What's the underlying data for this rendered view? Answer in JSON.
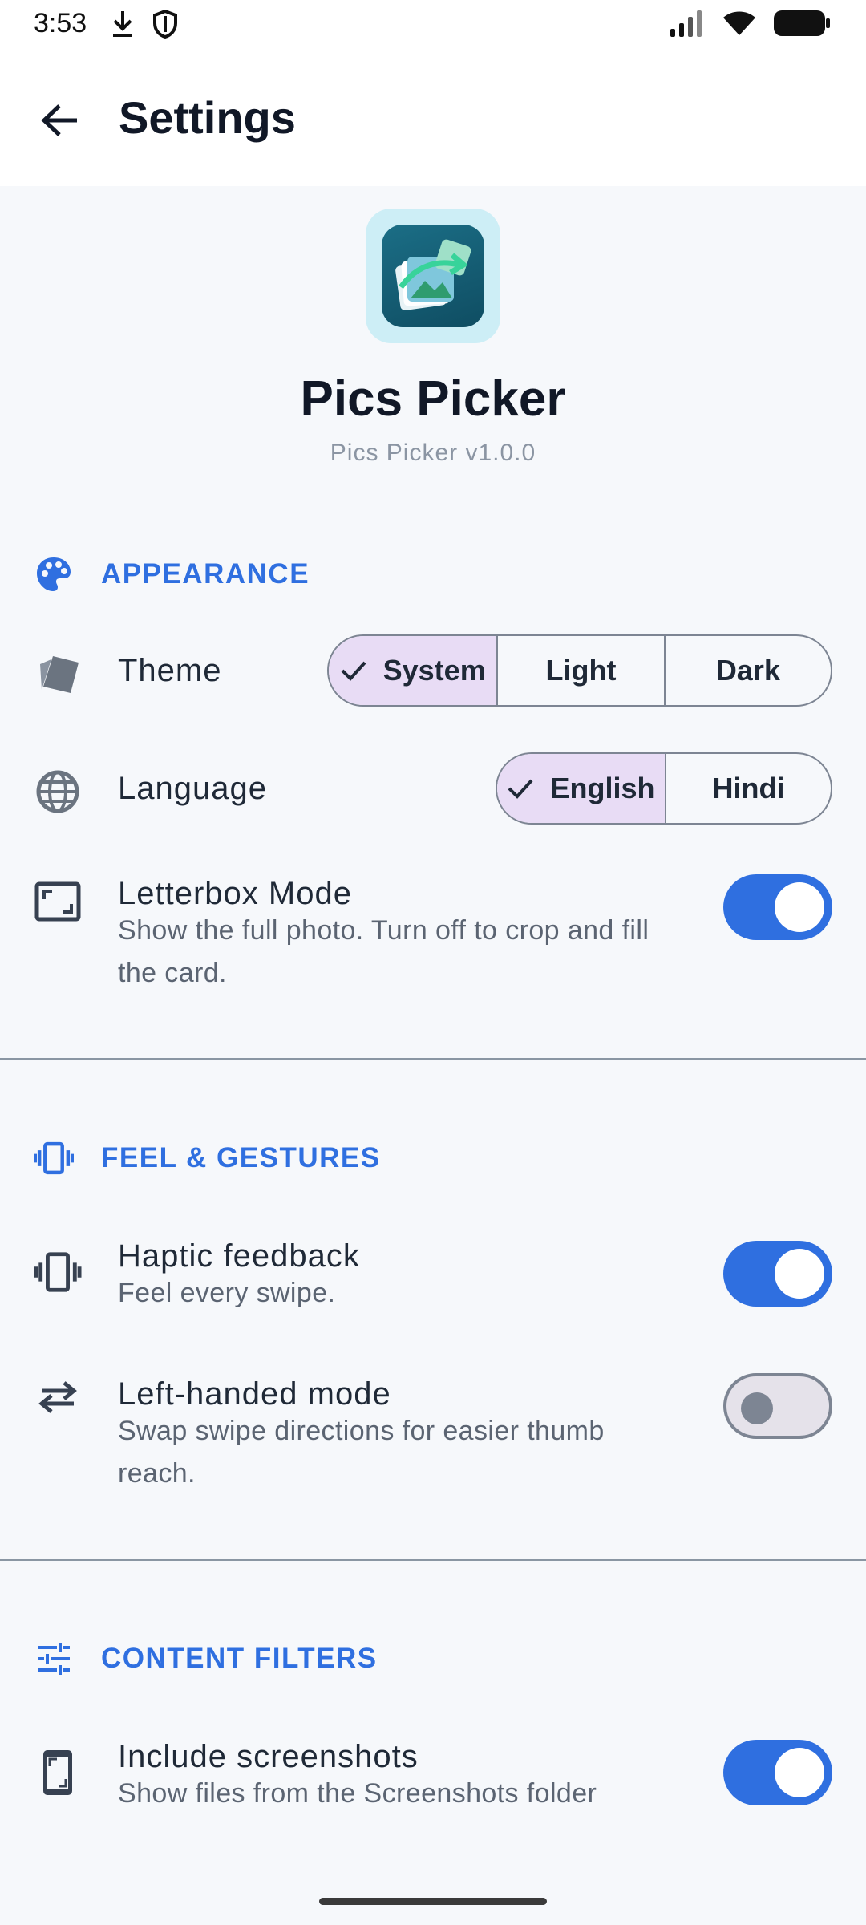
{
  "status_bar": {
    "time": "3:53"
  },
  "app_bar": {
    "title": "Settings"
  },
  "header": {
    "app_name": "Pics Picker",
    "version": "Pics Picker v1.0.0"
  },
  "sections": {
    "appearance": {
      "title": "APPEARANCE",
      "theme": {
        "label": "Theme",
        "options": [
          "System",
          "Light",
          "Dark"
        ],
        "selected": "System"
      },
      "language": {
        "label": "Language",
        "options": [
          "English",
          "Hindi"
        ],
        "selected": "English"
      },
      "letterbox": {
        "title": "Letterbox Mode",
        "subtitle": "Show the full photo. Turn off to crop and fill the card.",
        "enabled": true
      }
    },
    "feel": {
      "title": "FEEL & GESTURES",
      "haptic": {
        "title": "Haptic feedback",
        "subtitle": "Feel every swipe.",
        "enabled": true
      },
      "left_handed": {
        "title": "Left-handed mode",
        "subtitle": "Swap swipe directions for easier thumb reach.",
        "enabled": false
      }
    },
    "filters": {
      "title": "CONTENT FILTERS",
      "screenshots": {
        "title": "Include screenshots",
        "subtitle": "Show files from the Screenshots folder",
        "enabled": true
      }
    }
  },
  "colors": {
    "accent": "#2f6fe0",
    "selected_segment": "#e8dcf5",
    "background": "#f6f8fb"
  }
}
